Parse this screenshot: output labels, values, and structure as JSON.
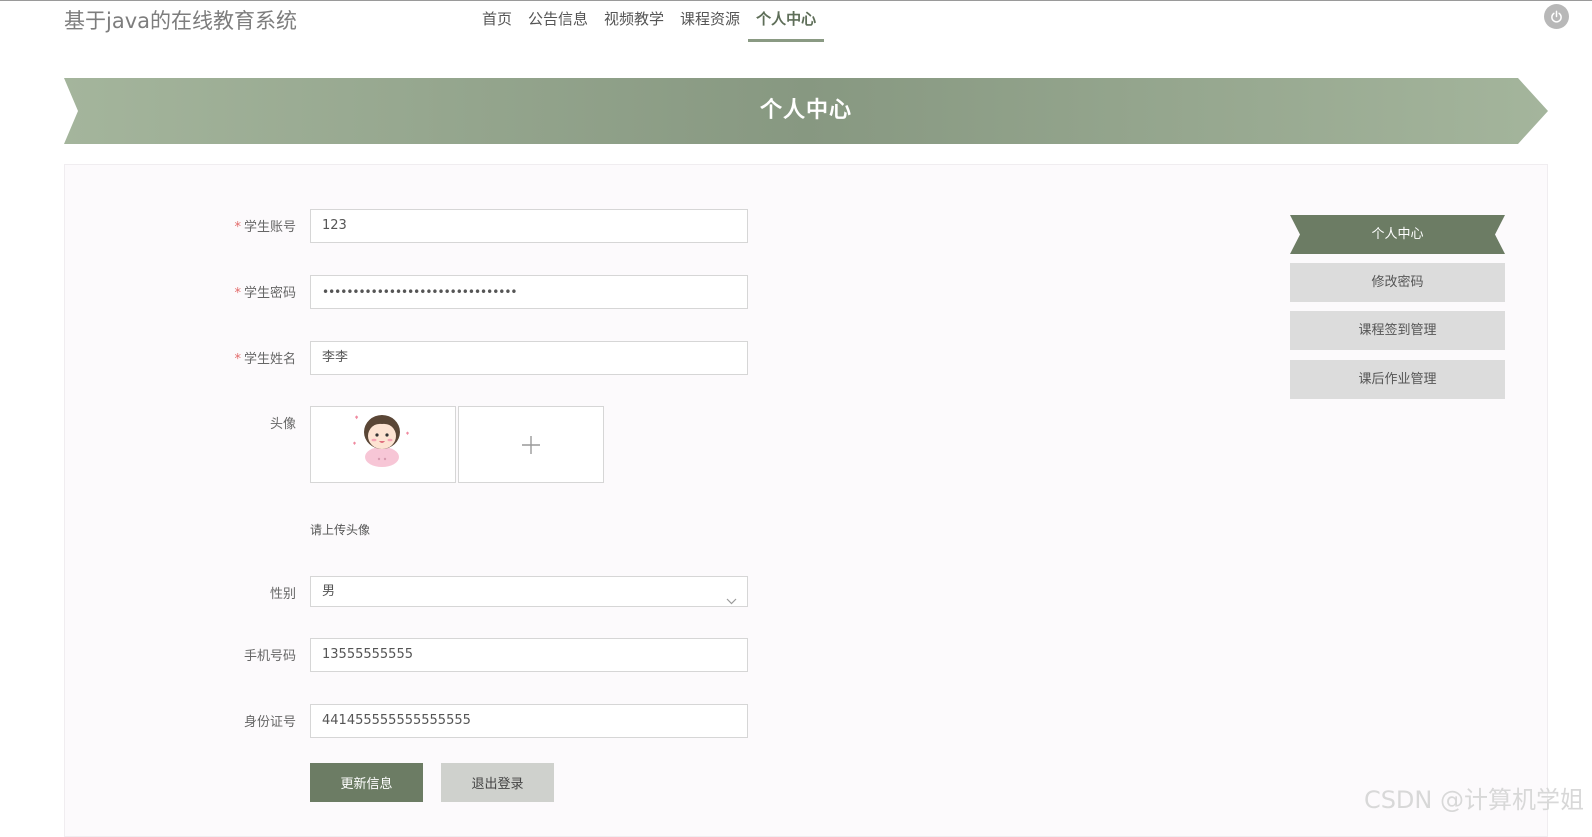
{
  "site_title": "基于java的在线教育系统",
  "nav": {
    "items": [
      {
        "label": "首页"
      },
      {
        "label": "公告信息"
      },
      {
        "label": "视频教学"
      },
      {
        "label": "课程资源"
      },
      {
        "label": "个人中心"
      }
    ],
    "active": "个人中心"
  },
  "icons": {
    "power": "power-icon",
    "chevron": "chevron-down-icon",
    "plus": "plus-icon"
  },
  "colors": {
    "accent": "#6c7c64",
    "banner_start": "#a4b59c",
    "banner_mid": "#8a9a83",
    "side_inactive": "#dcdcdc",
    "required": "#e36a6a"
  },
  "banner": {
    "title": "个人中心"
  },
  "form": {
    "account": {
      "label": "学生账号",
      "value": "123",
      "required": true
    },
    "password": {
      "label": "学生密码",
      "value": "••••••••••••••••••••••••••••••••",
      "required": true
    },
    "name": {
      "label": "学生姓名",
      "value": "李李",
      "required": true
    },
    "avatar": {
      "label": "头像",
      "hint": "请上传头像"
    },
    "gender": {
      "label": "性别",
      "value": "男"
    },
    "phone": {
      "label": "手机号码",
      "value": "13555555555"
    },
    "id_card": {
      "label": "身份证号",
      "value": "441455555555555555"
    }
  },
  "buttons": {
    "update": "更新信息",
    "logout": "退出登录"
  },
  "sidebar": {
    "items": [
      {
        "label": "个人中心"
      },
      {
        "label": "修改密码"
      },
      {
        "label": "课程签到管理"
      },
      {
        "label": "课后作业管理"
      }
    ]
  },
  "watermark": "CSDN @计算机学姐"
}
